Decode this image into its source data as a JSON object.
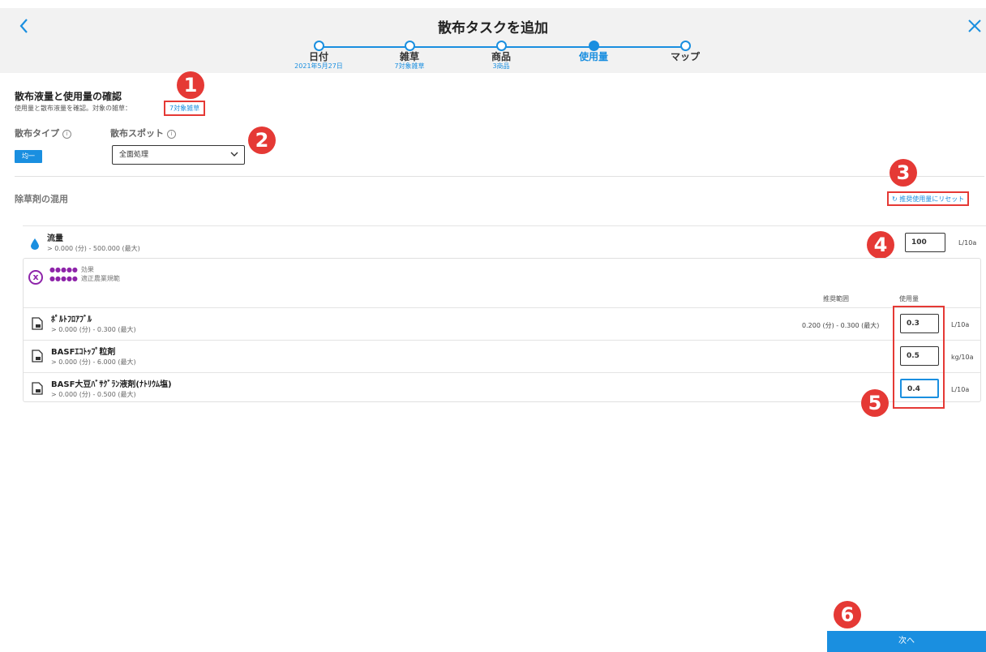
{
  "header": {
    "title": "散布タスクを追加",
    "back_icon": "chevron-left-icon",
    "close_icon": "close-icon"
  },
  "stepper": {
    "steps": [
      {
        "label": "日付",
        "sub": "2021年5月27日",
        "state": "done"
      },
      {
        "label": "雑草",
        "sub": "7対象雑草",
        "state": "done"
      },
      {
        "label": "商品",
        "sub": "3商品",
        "state": "done"
      },
      {
        "label": "使用量",
        "sub": "",
        "state": "active"
      },
      {
        "label": "マップ",
        "sub": "",
        "state": "pending"
      }
    ]
  },
  "section": {
    "title": "散布液量と使用量の確認",
    "description": "使用量と散布液量を確認。対象の雑草：",
    "weeds_link": "7対象雑草"
  },
  "spray_type": {
    "label": "散布タイプ",
    "value": "均一"
  },
  "spray_spot": {
    "label": "散布スポット",
    "value": "全面処理"
  },
  "mix": {
    "title": "除草剤の混用",
    "reset_label": "推奨使用量にリセット"
  },
  "flow": {
    "name": "流量",
    "range": "> 0.000 (分) - 500.000 (最大)",
    "value": "100",
    "unit": "L/10a"
  },
  "ratings": {
    "efficacy_stars": "●●●●●",
    "efficacy_label": "効果",
    "gap_stars": "●●●●●",
    "gap_label": "適正農業規範"
  },
  "columns": {
    "recommended": "推奨範囲",
    "rate": "使用量"
  },
  "products": [
    {
      "name": "ﾎﾟﾙﾄﾌﾛｱﾌﾞﾙ",
      "range": "> 0.000 (分) - 0.300 (最大)",
      "recommended": "0.200 (分) - 0.300 (最大)",
      "value": "0.3",
      "unit": "L/10a"
    },
    {
      "name": "BASFｴｺﾄｯﾌﾟ粒剤",
      "range": "> 0.000 (分) - 6.000 (最大)",
      "recommended": "",
      "value": "0.5",
      "unit": "kg/10a"
    },
    {
      "name": "BASF大豆ﾊﾞｻｸﾞﾗﾝ液剤(ﾅﾄﾘｳﾑ塩)",
      "range": "> 0.000 (分) - 0.500 (最大)",
      "recommended": "",
      "value": "0.4",
      "unit": "L/10a"
    }
  ],
  "annotations": [
    "1",
    "2",
    "3",
    "4",
    "5",
    "6"
  ],
  "footer": {
    "next_label": "次へ"
  },
  "colors": {
    "accent": "#1a8fe0",
    "annotation": "#e53935",
    "rating": "#8e24aa"
  }
}
